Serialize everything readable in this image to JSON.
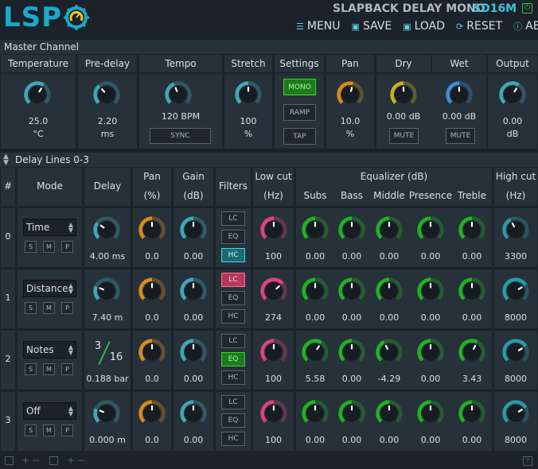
{
  "header": {
    "logo": "LSP",
    "plugin_name": "SLAPBACK DELAY MONO",
    "plugin_code": "SD16M",
    "menu": [
      "MENU",
      "SAVE",
      "LOAD",
      "RESET",
      "ABOUT"
    ],
    "menu_icons": [
      "menu-icon",
      "save-icon",
      "load-icon",
      "reset-icon",
      "about-icon"
    ]
  },
  "master": {
    "title": "Master Channel",
    "columns": [
      "Temperature",
      "Pre-delay",
      "Tempo",
      "Stretch",
      "Settings",
      "Pan",
      "Dry",
      "Wet",
      "Output"
    ],
    "temperature": {
      "value": "25.0",
      "unit": "°C"
    },
    "predelay": {
      "value": "2.20",
      "unit": "ms"
    },
    "tempo": {
      "value": "120 BPM",
      "sync": "SYNC"
    },
    "stretch": {
      "value": "100",
      "unit": "%"
    },
    "settings": [
      "MONO",
      "RAMP",
      "TAP"
    ],
    "pan": {
      "value": "10.0",
      "unit": "%"
    },
    "dry": {
      "value": "0.00 dB",
      "mute": "MUTE"
    },
    "wet": {
      "value": "0.00 dB",
      "mute": "MUTE"
    },
    "output": {
      "value": "0.00",
      "unit": "dB"
    }
  },
  "delay": {
    "title": "Delay Lines 0-3",
    "headers": {
      "num": "#",
      "mode": "Mode",
      "delay": "Delay",
      "pan": "Pan",
      "pan_unit": "(%)",
      "gain": "Gain",
      "gain_unit": "(dB)",
      "filters": "Filters",
      "lowcut": "Low cut",
      "lowcut_unit": "(Hz)",
      "eq": "Equalizer (dB)",
      "eq_bands": [
        "Subs",
        "Bass",
        "Middle",
        "Presence",
        "Treble"
      ],
      "highcut": "High cut",
      "highcut_unit": "(Hz)"
    },
    "smp": [
      "S",
      "M",
      "P"
    ],
    "filter_labels": [
      "LC",
      "EQ",
      "HC"
    ],
    "rows": [
      {
        "num": "0",
        "mode": "Time",
        "delay": "4.00 ms",
        "pan": "0.0",
        "gain": "0.00",
        "lowcut": "100",
        "eq": [
          "0.00",
          "0.00",
          "0.00",
          "0.00",
          "0.00"
        ],
        "highcut": "3300",
        "filters_on": [
          false,
          false,
          true
        ]
      },
      {
        "num": "1",
        "mode": "Distance",
        "delay": "7.40 m",
        "pan": "0.0",
        "gain": "0.00",
        "lowcut": "274",
        "eq": [
          "0.00",
          "0.00",
          "0.00",
          "0.00",
          "0.00"
        ],
        "highcut": "8000",
        "filters_on": [
          true,
          false,
          false
        ]
      },
      {
        "num": "2",
        "mode": "Notes",
        "delay": "0.188 bar",
        "frac_num": "3",
        "frac_den": "16",
        "pan": "0.0",
        "gain": "0.00",
        "lowcut": "100",
        "eq": [
          "5.58",
          "0.00",
          "-4.29",
          "0.00",
          "3.43"
        ],
        "highcut": "8000",
        "filters_on": [
          false,
          true,
          false
        ]
      },
      {
        "num": "3",
        "mode": "Off",
        "delay": "0.000 m",
        "pan": "0.0",
        "gain": "0.00",
        "lowcut": "100",
        "eq": [
          "0.00",
          "0.00",
          "0.00",
          "0.00",
          "0.00"
        ],
        "highcut": "8000",
        "filters_on": [
          false,
          false,
          false
        ]
      }
    ]
  },
  "colors": {
    "cyan": "#3fa7b8",
    "orange": "#d98a1a",
    "yellow": "#c8b21e",
    "blue": "#3d8fd6",
    "green": "#1fb31f",
    "pink": "#e0427a",
    "teal": "#2a9aa8"
  }
}
